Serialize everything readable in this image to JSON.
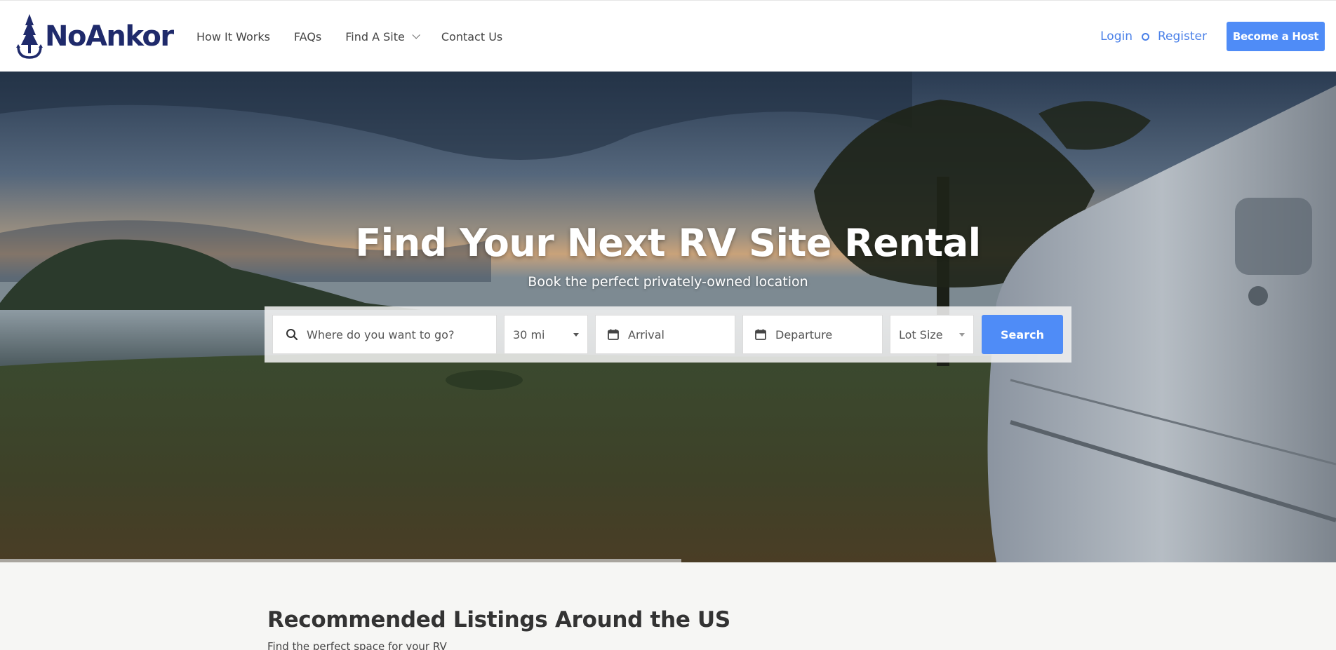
{
  "brand": {
    "name": "NoAnkor",
    "color": "#1f2a6b"
  },
  "nav": {
    "items": [
      {
        "label": "How It Works"
      },
      {
        "label": "FAQs"
      },
      {
        "label": "Find A Site"
      },
      {
        "label": "Contact Us"
      }
    ]
  },
  "auth": {
    "login": "Login",
    "register": "Register",
    "host_button": "Become a Host"
  },
  "hero": {
    "title": "Find Your Next RV Site Rental",
    "subtitle": "Book the perfect privately-owned location",
    "carousel_progress": 0.51
  },
  "search": {
    "where_placeholder": "Where do you want to go?",
    "distance": "30 mi",
    "arrival_placeholder": "Arrival",
    "departure_placeholder": "Departure",
    "lot_size": "Lot Size",
    "button": "Search"
  },
  "section": {
    "title": "Recommended Listings Around the US",
    "subtitle": "Find the perfect space for your RV"
  },
  "colors": {
    "accent": "#4f8cf7",
    "link": "#4a80e8"
  }
}
